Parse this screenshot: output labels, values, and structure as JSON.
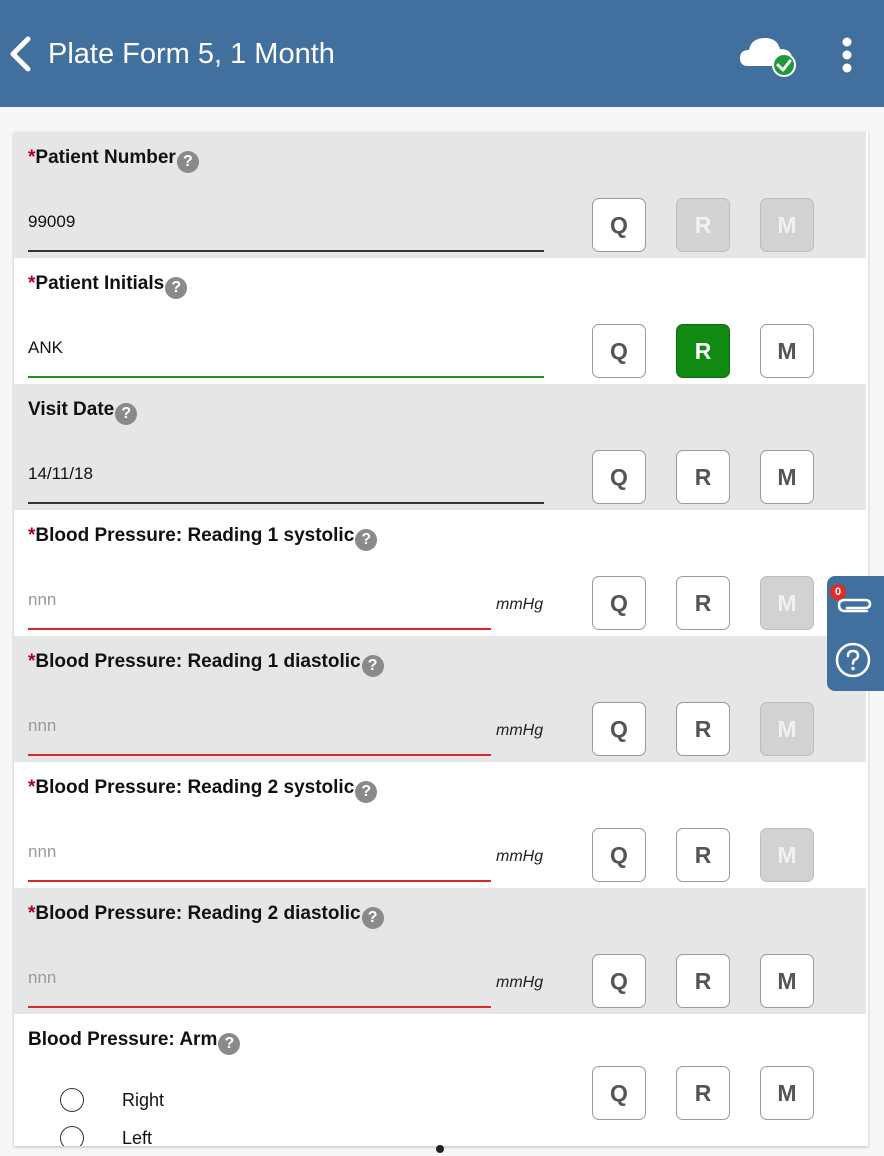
{
  "header": {
    "title": "Plate Form 5, 1 Month",
    "back_icon": "chevron-left-icon",
    "sync_icon": "cloud-check-icon",
    "menu_icon": "more-vertical-icon"
  },
  "fields": [
    {
      "required": "*",
      "label": "Patient Number",
      "value": "99009",
      "placeholder": "",
      "unit": "",
      "buttons": {
        "q": "Q",
        "r": "R",
        "m": "M"
      }
    },
    {
      "required": "*",
      "label": "Patient Initials",
      "value": "ANK",
      "placeholder": "",
      "unit": "",
      "buttons": {
        "q": "Q",
        "r": "R",
        "m": "M"
      }
    },
    {
      "required": "",
      "label": "Visit Date",
      "value": "14/11/18",
      "placeholder": "",
      "unit": "",
      "buttons": {
        "q": "Q",
        "r": "R",
        "m": "M"
      }
    },
    {
      "required": "*",
      "label": "Blood Pressure: Reading 1 systolic",
      "value": "",
      "placeholder": "nnn",
      "unit": "mmHg",
      "buttons": {
        "q": "Q",
        "r": "R",
        "m": "M"
      }
    },
    {
      "required": "*",
      "label": "Blood Pressure: Reading 1 diastolic",
      "value": "",
      "placeholder": "nnn",
      "unit": "mmHg",
      "buttons": {
        "q": "Q",
        "r": "R",
        "m": "M"
      }
    },
    {
      "required": "*",
      "label": "Blood Pressure: Reading 2 systolic",
      "value": "",
      "placeholder": "nnn",
      "unit": "mmHg",
      "buttons": {
        "q": "Q",
        "r": "R",
        "m": "M"
      }
    },
    {
      "required": "*",
      "label": "Blood Pressure: Reading 2 diastolic",
      "value": "",
      "placeholder": "nnn",
      "unit": "mmHg",
      "buttons": {
        "q": "Q",
        "r": "R",
        "m": "M"
      }
    },
    {
      "required": "",
      "label": "Blood Pressure: Arm",
      "options": [
        "Right",
        "Left"
      ],
      "buttons": {
        "q": "Q",
        "r": "R",
        "m": "M"
      }
    }
  ],
  "help_glyph": "?",
  "side_panel": {
    "attachments_count": "0",
    "attachment_icon": "paperclip-icon",
    "help_icon": "help-circle-icon"
  },
  "colors": {
    "header": "#416f9e",
    "required": "#b0001e",
    "valid_underline": "#2a8a22",
    "error_underline": "#d42a2a",
    "active_button": "#118a12"
  }
}
